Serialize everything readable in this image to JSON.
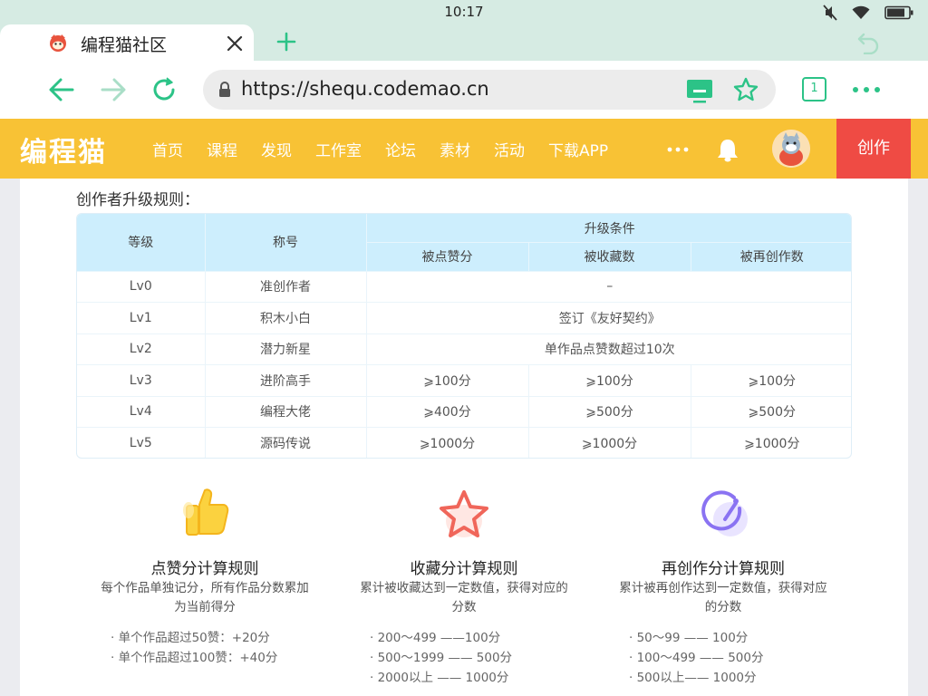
{
  "status_bar": {
    "time": "10:17"
  },
  "browser": {
    "tab_title": "编程猫社区",
    "url": "https://shequ.codemao.cn",
    "tab_count": "1"
  },
  "site": {
    "logo": "编程猫",
    "nav": [
      "首页",
      "课程",
      "发现",
      "工作室",
      "论坛",
      "素材",
      "活动",
      "下载APP"
    ],
    "create_label": "创作"
  },
  "section_title": "创作者升级规则：",
  "table": {
    "headers": {
      "level": "等级",
      "name": "称号",
      "conditions": "升级条件",
      "likes": "被点赞分",
      "favorites": "被收藏数",
      "remixes": "被再创作数"
    },
    "rows": [
      {
        "level": "Lv0",
        "name": "准创作者",
        "merged": "–"
      },
      {
        "level": "Lv1",
        "name": "积木小白",
        "merged": "签订《友好契约》"
      },
      {
        "level": "Lv2",
        "name": "潜力新星",
        "merged": "单作品点赞数超过10次"
      },
      {
        "level": "Lv3",
        "name": "进阶高手",
        "likes": "⩾100分",
        "favorites": "⩾100分",
        "remixes": "⩾100分"
      },
      {
        "level": "Lv4",
        "name": "编程大佬",
        "likes": "⩾400分",
        "favorites": "⩾500分",
        "remixes": "⩾500分"
      },
      {
        "level": "Lv5",
        "name": "源码传说",
        "likes": "⩾1000分",
        "favorites": "⩾1000分",
        "remixes": "⩾1000分"
      }
    ]
  },
  "rules": [
    {
      "icon": "thumbs-up-icon",
      "title": "点赞分计算规则",
      "desc_line1": "每个作品单独记分，所有作品分数累加",
      "desc_line2": "为当前得分",
      "items": [
        "· 单个作品超过50赞：+20分",
        "· 单个作品超过100赞：+40分"
      ]
    },
    {
      "icon": "star-icon",
      "title": "收藏分计算规则",
      "desc_line1": "累计被收藏达到一定数值，获得对应的",
      "desc_line2": "分数",
      "items": [
        "· 200～499 ——100分",
        "· 500～1999 —— 500分",
        "· 2000以上 —— 1000分"
      ]
    },
    {
      "icon": "remix-icon",
      "title": "再创作分计算规则",
      "desc_line1": "累计被再创作达到一定数值，获得对应",
      "desc_line2": "的分数",
      "items": [
        "· 50～99 —— 100分",
        "· 100～499 —— 500分",
        "· 500以上—— 1000分"
      ]
    }
  ],
  "colors": {
    "accent_green": "#2cc387",
    "header_yellow": "#f8c235",
    "create_red": "#ef4b44",
    "table_header_blue": "#cdeefd"
  }
}
